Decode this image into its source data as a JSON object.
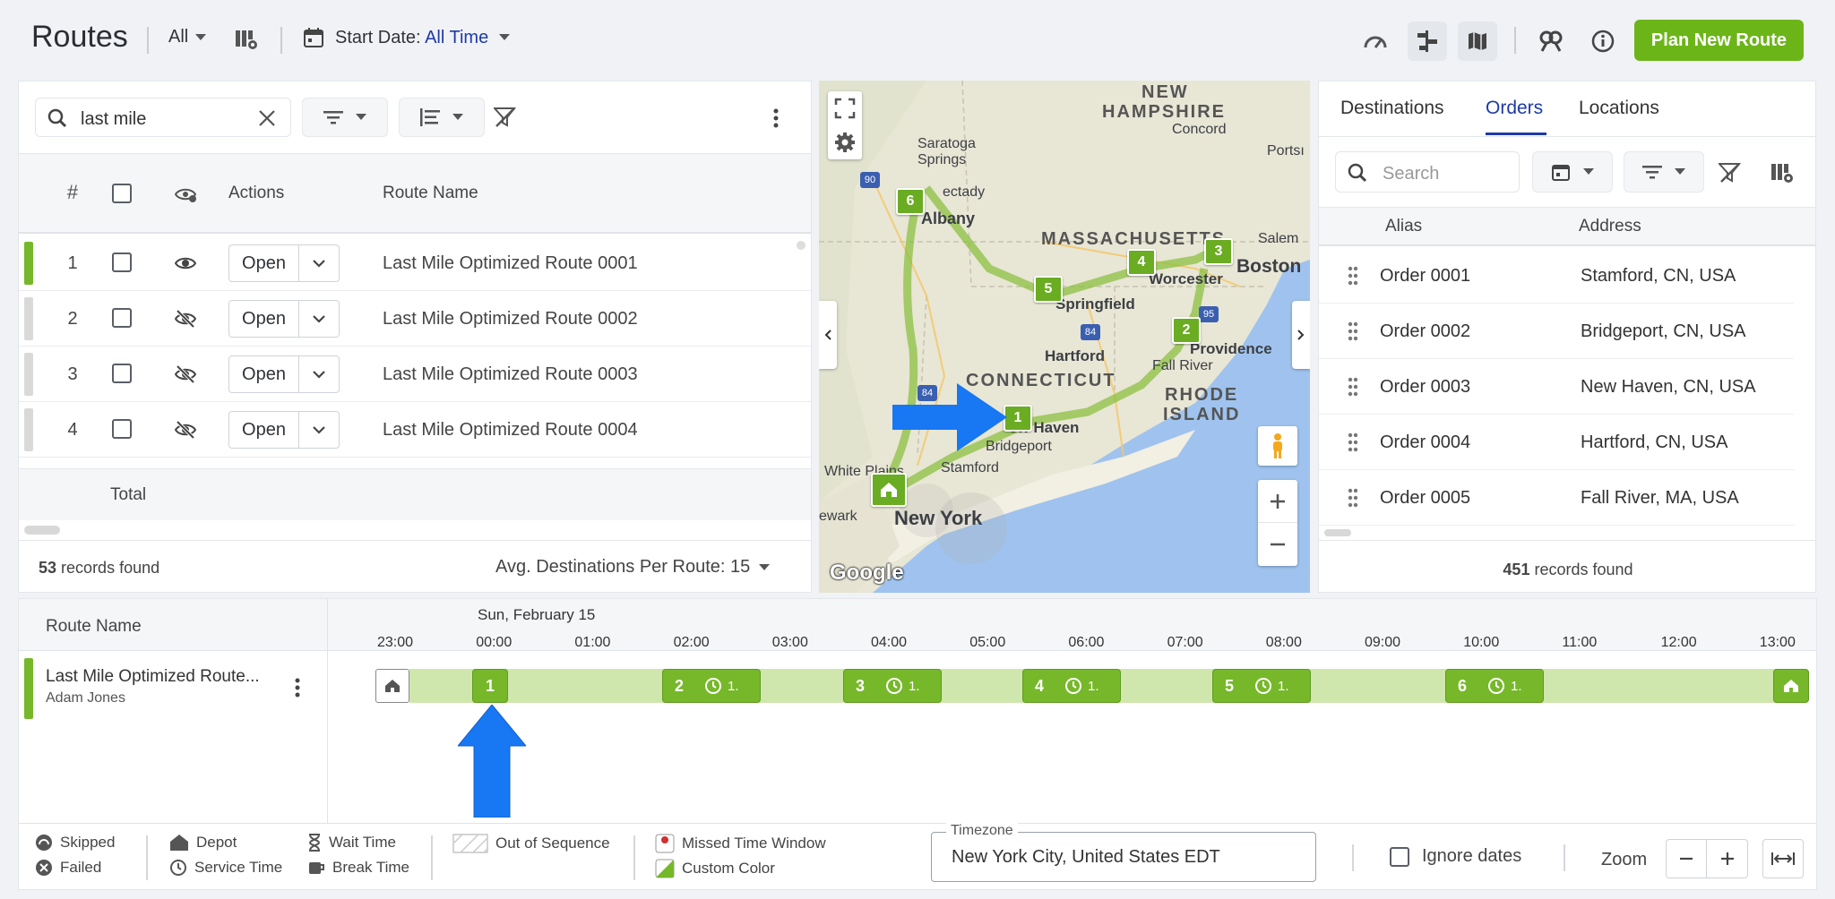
{
  "header": {
    "title": "Routes",
    "filter_value": "All",
    "start_date_label": "Start Date:",
    "start_date_value": "All Time",
    "plan_button": "Plan New Route"
  },
  "routes_panel": {
    "search_value": "last mile",
    "columns": {
      "number": "#",
      "actions": "Actions",
      "route_name": "Route Name"
    },
    "rows": [
      {
        "num": "1",
        "open": "Open",
        "name": "Last Mile Optimized Route 0001",
        "visible": true,
        "color": "#76b82a"
      },
      {
        "num": "2",
        "open": "Open",
        "name": "Last Mile Optimized Route 0002",
        "visible": false,
        "color": "#d9d9d9"
      },
      {
        "num": "3",
        "open": "Open",
        "name": "Last Mile Optimized Route 0003",
        "visible": false,
        "color": "#d9d9d9"
      },
      {
        "num": "4",
        "open": "Open",
        "name": "Last Mile Optimized Route 0004",
        "visible": false,
        "color": "#d9d9d9"
      }
    ],
    "total_label": "Total",
    "records_count": "53",
    "records_suffix": "records found",
    "avg_label": "Avg. Destinations Per Route: 15"
  },
  "map": {
    "labels": {
      "nh": "NEW",
      "nh2": "HAMPSHIRE",
      "concord": "Concord",
      "portsmouth": "Portsı",
      "saratoga": "Saratoga",
      "saratoga2": "Springs",
      "schenectady": "ectady",
      "albany": "Albany",
      "ma": "MASSACHUSETTS",
      "salem": "Salem",
      "worcester": "Worcester",
      "boston": "Boston",
      "springfield": "Springfield",
      "hartford": "Hartford",
      "providence": "Providence",
      "ct": "CONNECTICUT",
      "ri": "RHODE",
      "ri2": "ISLAND",
      "fallriver": "Fall River",
      "newhaven": "ew Haven",
      "bridgeport": "Bridgeport",
      "stamford": "Stamford",
      "whiteplains": "White Plains",
      "newark": "ewark",
      "newyork": "New York",
      "google": "Google",
      "shield90": "90",
      "shield84a": "84",
      "shield84b": "84",
      "shield95": "95"
    },
    "markers": [
      "1",
      "2",
      "3",
      "4",
      "5",
      "6"
    ]
  },
  "orders_panel": {
    "tabs": [
      "Destinations",
      "Orders",
      "Locations"
    ],
    "active_tab": "Orders",
    "search_placeholder": "Search",
    "columns": {
      "alias": "Alias",
      "address": "Address"
    },
    "rows": [
      {
        "alias": "Order 0001",
        "address": "Stamford, CN, USA"
      },
      {
        "alias": "Order 0002",
        "address": "Bridgeport, CN, USA"
      },
      {
        "alias": "Order 0003",
        "address": "New Haven, CN, USA"
      },
      {
        "alias": "Order 0004",
        "address": "Hartford, CN, USA"
      },
      {
        "alias": "Order 0005",
        "address": "Fall River, MA, USA"
      }
    ],
    "records_count": "451",
    "records_suffix": "records found"
  },
  "timeline": {
    "route_name_header": "Route Name",
    "date_label": "Sun, February 15",
    "ticks": [
      "23:00",
      "00:00",
      "01:00",
      "02:00",
      "03:00",
      "04:00",
      "05:00",
      "06:00",
      "07:00",
      "08:00",
      "09:00",
      "10:00",
      "11:00",
      "12:00",
      "13:00"
    ],
    "route_name": "Last Mile Optimized Route...",
    "driver": "Adam Jones",
    "stops": [
      {
        "n": "1",
        "extra": ""
      },
      {
        "n": "2",
        "extra": "1."
      },
      {
        "n": "3",
        "extra": "1."
      },
      {
        "n": "4",
        "extra": "1."
      },
      {
        "n": "5",
        "extra": "1."
      },
      {
        "n": "6",
        "extra": "1."
      }
    ]
  },
  "legend": {
    "skipped": "Skipped",
    "failed": "Failed",
    "depot": "Depot",
    "service_time": "Service Time",
    "wait_time": "Wait Time",
    "break_time": "Break Time",
    "out_of_sequence": "Out of Sequence",
    "missed_window": "Missed Time Window",
    "custom_color": "Custom Color"
  },
  "footer": {
    "timezone_label": "Timezone",
    "timezone_value": "New York City, United States EDT",
    "ignore_dates": "Ignore dates",
    "zoom": "Zoom"
  },
  "colors": {
    "accent": "#76b82a",
    "primary_blue": "#1e3aa8",
    "arrow_blue": "#1877f2"
  }
}
